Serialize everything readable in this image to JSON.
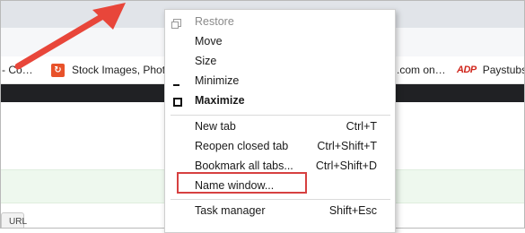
{
  "browser": {
    "bookmarks": [
      {
        "label": "- Co…"
      },
      {
        "label": "Stock Images, Phot…",
        "icon": "stock-images-icon"
      },
      {
        "label": ".com on…"
      },
      {
        "label": "Paystubs",
        "icon": "adp-logo-icon",
        "logo_text": "ADP"
      }
    ],
    "url_tab_label": "URL"
  },
  "context_menu": {
    "items": [
      {
        "label": "Restore",
        "shortcut": "",
        "disabled": true,
        "icon": "restore-icon"
      },
      {
        "label": "Move",
        "shortcut": ""
      },
      {
        "label": "Size",
        "shortcut": ""
      },
      {
        "label": "Minimize",
        "shortcut": "",
        "icon": "minimize-icon"
      },
      {
        "label": "Maximize",
        "shortcut": "",
        "bold": true,
        "icon": "maximize-icon"
      },
      {
        "label": "New tab",
        "shortcut": "Ctrl+T"
      },
      {
        "label": "Reopen closed tab",
        "shortcut": "Ctrl+Shift+T"
      },
      {
        "label": "Bookmark all tabs...",
        "shortcut": "Ctrl+Shift+D"
      },
      {
        "label": "Name window...",
        "shortcut": "",
        "highlighted": true
      },
      {
        "label": "Task manager",
        "shortcut": "Shift+Esc"
      }
    ]
  },
  "annotation": {
    "arrow_color": "#e8463a",
    "highlight_color": "#d64040"
  }
}
